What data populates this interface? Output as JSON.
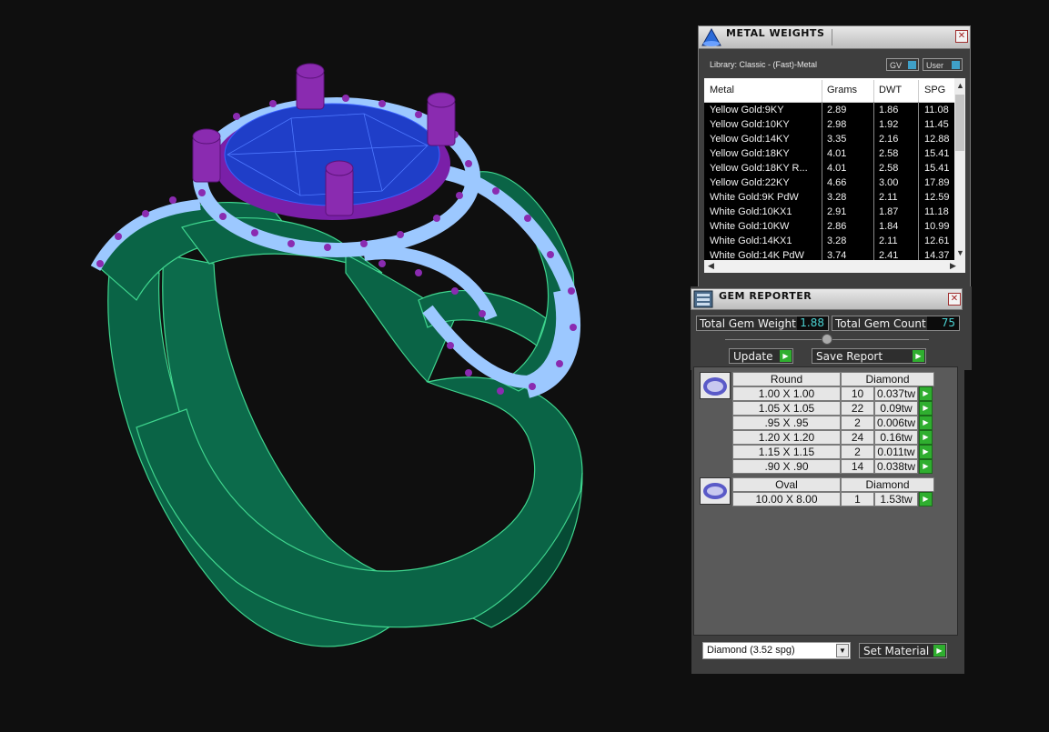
{
  "metal_weights": {
    "title": "METAL WEIGHTS",
    "library": "Library: Classic - (Fast)-Metal",
    "gv_label": "GV",
    "user_label": "User",
    "columns": [
      "Metal",
      "Grams",
      "DWT",
      "SPG"
    ],
    "rows": [
      [
        "Yellow Gold:9KY",
        "2.89",
        "1.86",
        "11.08"
      ],
      [
        "Yellow Gold:10KY",
        "2.98",
        "1.92",
        "11.45"
      ],
      [
        "Yellow Gold:14KY",
        "3.35",
        "2.16",
        "12.88"
      ],
      [
        "Yellow Gold:18KY",
        "4.01",
        "2.58",
        "15.41"
      ],
      [
        "Yellow Gold:18KY R...",
        "4.01",
        "2.58",
        "15.41"
      ],
      [
        "Yellow Gold:22KY",
        "4.66",
        "3.00",
        "17.89"
      ],
      [
        "White Gold:9K PdW",
        "3.28",
        "2.11",
        "12.59"
      ],
      [
        "White Gold:10KX1",
        "2.91",
        "1.87",
        "11.18"
      ],
      [
        "White Gold:10KW",
        "2.86",
        "1.84",
        "10.99"
      ],
      [
        "White Gold:14KX1",
        "3.28",
        "2.11",
        "12.61"
      ],
      [
        "White Gold:14K PdW",
        "3.74",
        "2.41",
        "14.37"
      ]
    ]
  },
  "gem_reporter": {
    "title": "GEM REPORTER",
    "total_weight_label": "Total Gem Weight",
    "total_weight_value": "1.88",
    "total_count_label": "Total Gem Count",
    "total_count_value": "75",
    "update_label": "Update",
    "save_report_label": "Save Report",
    "groups": [
      {
        "shape": "Round",
        "material": "Diamond",
        "rows": [
          [
            "1.00 X 1.00",
            "10",
            "0.037tw"
          ],
          [
            "1.05 X 1.05",
            "22",
            "0.09tw"
          ],
          [
            ".95 X .95",
            "2",
            "0.006tw"
          ],
          [
            "1.20 X 1.20",
            "24",
            "0.16tw"
          ],
          [
            "1.15 X 1.15",
            "2",
            "0.011tw"
          ],
          [
            ".90 X .90",
            "14",
            "0.038tw"
          ]
        ]
      },
      {
        "shape": "Oval",
        "material": "Diamond",
        "rows": [
          [
            "10.00 X 8.00",
            "1",
            "1.53tw"
          ]
        ]
      }
    ],
    "material_select": "Diamond    (3.52 spg)",
    "set_material_label": "Set Material"
  }
}
